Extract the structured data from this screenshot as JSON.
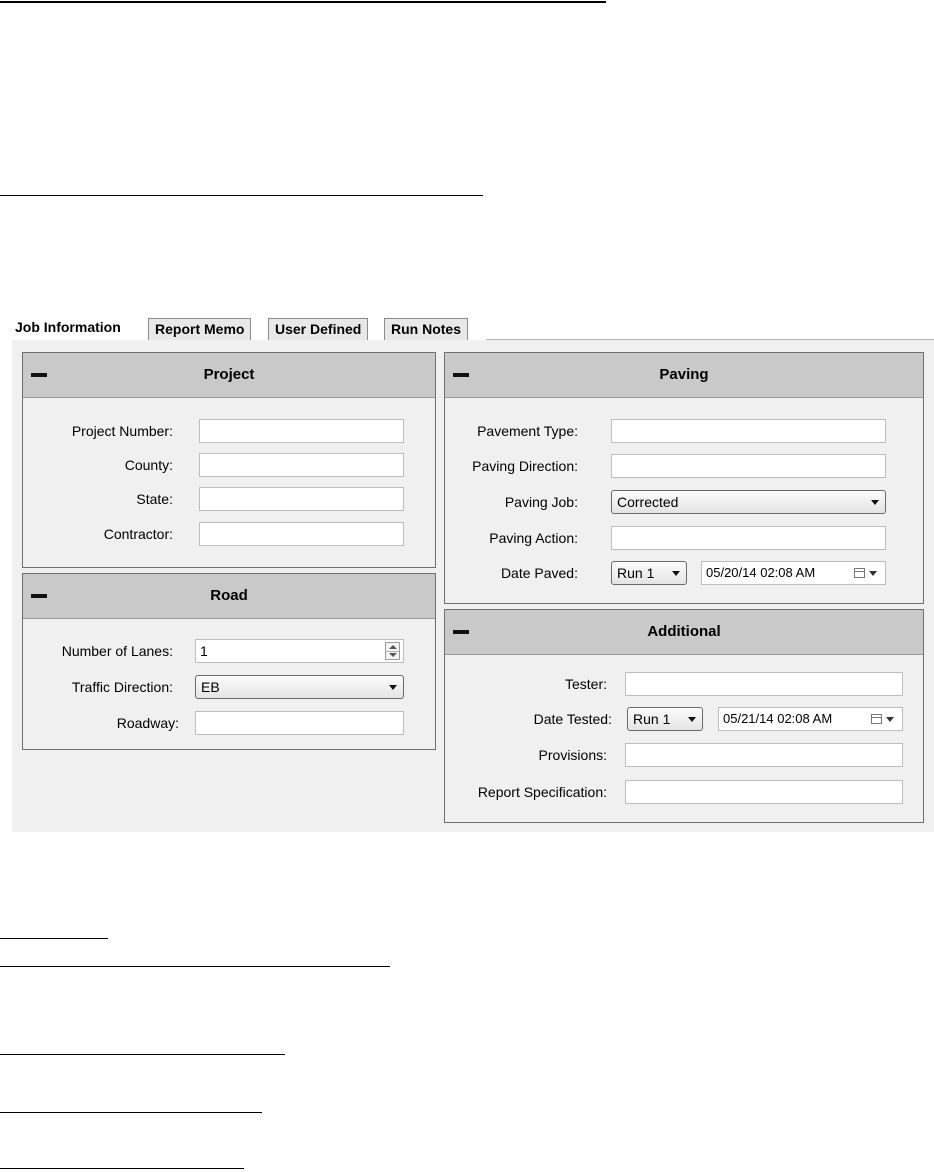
{
  "tabs": [
    {
      "label": "Job Information",
      "active": true
    },
    {
      "label": "Report Memo",
      "active": false
    },
    {
      "label": "User Defined",
      "active": false
    },
    {
      "label": "Run Notes",
      "active": false
    }
  ],
  "project": {
    "title": "Project",
    "fields": [
      {
        "label": "Project Number:",
        "value": ""
      },
      {
        "label": "County:",
        "value": ""
      },
      {
        "label": "State:",
        "value": ""
      },
      {
        "label": "Contractor:",
        "value": ""
      }
    ]
  },
  "road": {
    "title": "Road",
    "lanes_label": "Number of Lanes:",
    "lanes_value": "1",
    "traffic_label": "Traffic Direction:",
    "traffic_value": "EB",
    "roadway_label": "Roadway:",
    "roadway_value": ""
  },
  "paving": {
    "title": "Paving",
    "pavement_type_label": "Pavement Type:",
    "paving_direction_label": "Paving Direction:",
    "paving_job_label": "Paving Job:",
    "paving_job_value": "Corrected",
    "paving_action_label": "Paving Action:",
    "date_paved_label": "Date Paved:",
    "date_paved_run": "Run 1",
    "date_paved_value": "05/20/14  02:08 AM"
  },
  "additional": {
    "title": "Additional",
    "tester_label": "Tester:",
    "date_tested_label": "Date Tested:",
    "date_tested_run": "Run 1",
    "date_tested_value": "05/21/14  02:08 AM",
    "provisions_label": "Provisions:",
    "report_spec_label": "Report Specification:"
  },
  "colors": {
    "panel_background": "#f0f0f0",
    "group_header": "#c9c9c9",
    "field_background": "#ffffff"
  }
}
